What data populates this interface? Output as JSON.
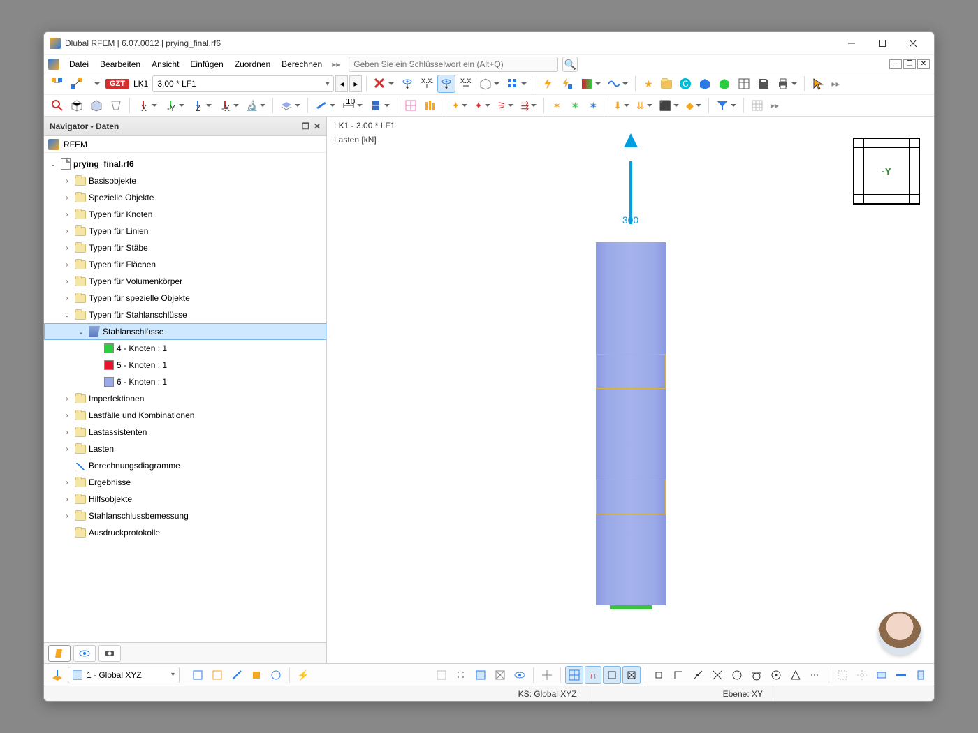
{
  "title": "Dlubal RFEM | 6.07.0012 | prying_final.rf6",
  "menu": [
    "Datei",
    "Bearbeiten",
    "Ansicht",
    "Einfügen",
    "Zuordnen",
    "Berechnen"
  ],
  "search_placeholder": "Geben Sie ein Schlüsselwort ein (Alt+Q)",
  "lc_badge": "GZT",
  "lc_label": "LK1",
  "lc_desc": "3.00 * LF1",
  "navigator": {
    "title": "Navigator - Daten",
    "root": "RFEM",
    "file": "prying_final.rf6",
    "items": [
      "Basisobjekte",
      "Spezielle Objekte",
      "Typen für Knoten",
      "Typen für Linien",
      "Typen für Stäbe",
      "Typen für Flächen",
      "Typen für Volumenkörper",
      "Typen für spezielle Objekte"
    ],
    "steel_parent": "Typen für Stahlanschlüsse",
    "steel_node": "Stahlanschlüsse",
    "steel_children": [
      {
        "color": "#2ecc40",
        "label": "4 - Knoten : 1"
      },
      {
        "color": "#e8132b",
        "label": "5 - Knoten : 1"
      },
      {
        "color": "#9aa9e8",
        "label": "6 - Knoten : 1"
      }
    ],
    "items2": [
      {
        "label": "Imperfektionen",
        "icon": "folder",
        "tw": "›"
      },
      {
        "label": "Lastfälle und Kombinationen",
        "icon": "folder",
        "tw": "›"
      },
      {
        "label": "Lastassistenten",
        "icon": "folder",
        "tw": "›"
      },
      {
        "label": "Lasten",
        "icon": "folder",
        "tw": "›"
      },
      {
        "label": "Berechnungsdiagramme",
        "icon": "chart",
        "tw": ""
      },
      {
        "label": "Ergebnisse",
        "icon": "folder",
        "tw": "›"
      },
      {
        "label": "Hilfsobjekte",
        "icon": "folder",
        "tw": "›"
      },
      {
        "label": "Stahlanschlussbemessung",
        "icon": "folder",
        "tw": "›"
      },
      {
        "label": "Ausdruckprotokolle",
        "icon": "folder",
        "tw": ""
      }
    ]
  },
  "viewport": {
    "line1": "LK1 - 3.00 * LF1",
    "line2": "Lasten [kN]",
    "load_value": "300",
    "axis_label": "-Y"
  },
  "cs_combo": "1 - Global XYZ",
  "status": {
    "ks": "KS: Global XYZ",
    "ebene": "Ebene: XY"
  }
}
